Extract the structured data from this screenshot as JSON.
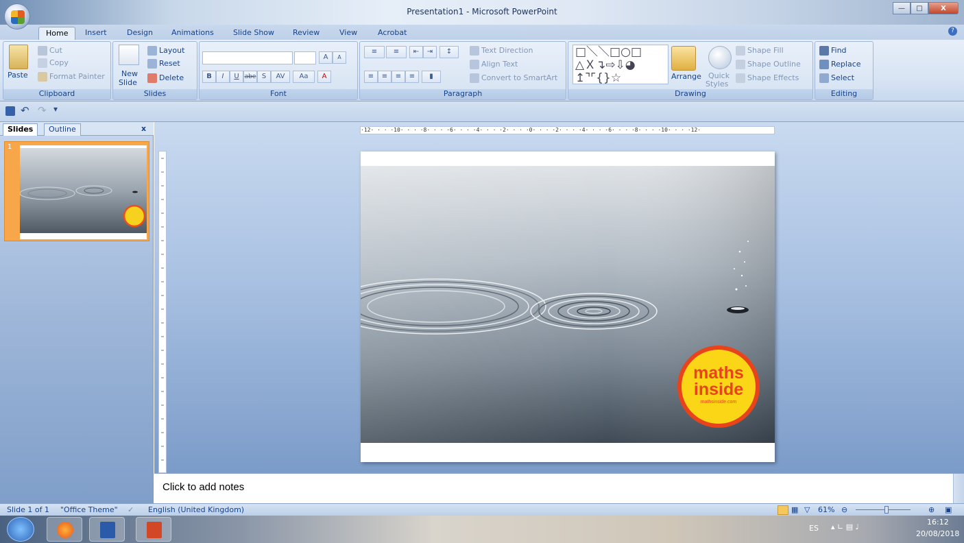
{
  "window": {
    "title": "Presentation1 - Microsoft PowerPoint"
  },
  "tabs": [
    "Home",
    "Insert",
    "Design",
    "Animations",
    "Slide Show",
    "Review",
    "View",
    "Acrobat"
  ],
  "ribbon": {
    "clipboard": {
      "label": "Clipboard",
      "paste": "Paste",
      "cut": "Cut",
      "copy": "Copy",
      "format_painter": "Format Painter"
    },
    "slides": {
      "label": "Slides",
      "new_slide_line1": "New",
      "new_slide_line2": "Slide",
      "layout": "Layout",
      "reset": "Reset",
      "delete": "Delete"
    },
    "font": {
      "label": "Font",
      "bold": "B",
      "italic": "I",
      "underline": "U",
      "strike": "abe",
      "shadow": "S",
      "spacing": "AV",
      "case": "Aa",
      "color": "A",
      "grow": "A",
      "shrink": "A"
    },
    "paragraph": {
      "label": "Paragraph",
      "text_direction": "Text Direction",
      "align_text": "Align Text",
      "convert_smartart": "Convert to SmartArt"
    },
    "drawing": {
      "label": "Drawing",
      "arrange": "Arrange",
      "quick_styles_line1": "Quick",
      "quick_styles_line2": "Styles",
      "shape_fill": "Shape Fill",
      "shape_outline": "Shape Outline",
      "shape_effects": "Shape Effects"
    },
    "editing": {
      "label": "Editing",
      "find": "Find",
      "replace": "Replace",
      "select": "Select"
    }
  },
  "left_pane": {
    "tab_slides": "Slides",
    "tab_outline": "Outline",
    "close": "x",
    "slide_number": "1"
  },
  "ruler": {
    "horizontal": "·12· · · ·10· · · ·8· · · ·6· · · ·4· · · ·2· · · ·0· · · ·2· · · ·4· · · ·6· · · ·8· · · ·10· · · ·12·"
  },
  "slide": {
    "logo_line1": "maths",
    "logo_line2": "inside",
    "logo_url": "mathsinside.com"
  },
  "notes": {
    "placeholder": "Click to add notes"
  },
  "status": {
    "slide_info": "Slide 1 of 1",
    "theme": "\"Office Theme\"",
    "language": "English (United Kingdom)",
    "zoom": "61%"
  },
  "taskbar": {
    "lang": "ES",
    "time": "16:12",
    "date": "20/08/2018"
  }
}
